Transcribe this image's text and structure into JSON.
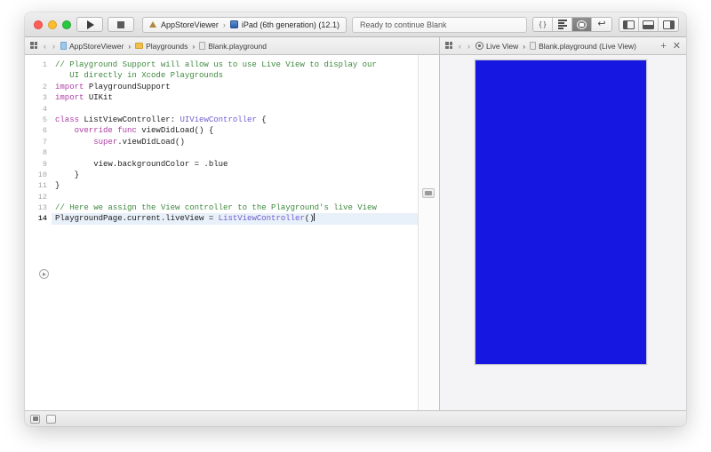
{
  "window": {
    "traffic_lights": [
      "close",
      "minimize",
      "zoom"
    ]
  },
  "toolbar": {
    "run_label": "Run",
    "stop_label": "Stop",
    "scheme_name": "AppStoreViewer",
    "scheme_separator": "›",
    "destination": "iPad (6th generation) (12.1)",
    "status_text": "Ready to continue Blank",
    "editor_segments": [
      {
        "name": "code-braces",
        "glyph": "{ }",
        "active": false
      },
      {
        "name": "standard-editor",
        "glyph": "",
        "active": false
      },
      {
        "name": "assistant-editor",
        "glyph": "",
        "active": true
      },
      {
        "name": "version-editor",
        "glyph": "↩",
        "active": false
      }
    ],
    "view_toggles": [
      {
        "name": "navigator",
        "state": "hidden"
      },
      {
        "name": "debug-area",
        "state": "hidden"
      },
      {
        "name": "inspector",
        "state": "hidden"
      }
    ]
  },
  "editor_pane": {
    "jumpbar": {
      "back_glyph": "‹",
      "forward_glyph": "›",
      "separator": "›",
      "crumbs": [
        {
          "label": "AppStoreViewer",
          "icon": "project-icon"
        },
        {
          "label": "Playgrounds",
          "icon": "folder-icon"
        },
        {
          "label": "Blank.playground",
          "icon": "playground-icon"
        }
      ]
    },
    "lines": [
      {
        "n": "1",
        "tokens": [
          {
            "t": "// Playground Support will allow us to use Live View to display our",
            "c": "k-comment"
          }
        ]
      },
      {
        "n": "",
        "tokens": [
          {
            "t": "   UI directly in Xcode Playgrounds",
            "c": "k-comment"
          }
        ]
      },
      {
        "n": "2",
        "tokens": [
          {
            "t": "import ",
            "c": "k-keyword"
          },
          {
            "t": "PlaygroundSupport",
            "c": "k-plain"
          }
        ]
      },
      {
        "n": "3",
        "tokens": [
          {
            "t": "import ",
            "c": "k-keyword"
          },
          {
            "t": "UIKit",
            "c": "k-plain"
          }
        ]
      },
      {
        "n": "4",
        "tokens": [
          {
            "t": "",
            "c": "k-plain"
          }
        ]
      },
      {
        "n": "5",
        "tokens": [
          {
            "t": "class ",
            "c": "k-keyword"
          },
          {
            "t": "ListViewController",
            "c": "k-plain"
          },
          {
            "t": ": ",
            "c": "k-plain"
          },
          {
            "t": "UIViewController",
            "c": "k-type"
          },
          {
            "t": " {",
            "c": "k-plain"
          }
        ]
      },
      {
        "n": "6",
        "tokens": [
          {
            "t": "    ",
            "c": "k-plain"
          },
          {
            "t": "override func ",
            "c": "k-keyword"
          },
          {
            "t": "viewDidLoad() {",
            "c": "k-plain"
          }
        ]
      },
      {
        "n": "7",
        "tokens": [
          {
            "t": "        ",
            "c": "k-plain"
          },
          {
            "t": "super",
            "c": "k-keyword"
          },
          {
            "t": ".viewDidLoad()",
            "c": "k-plain"
          }
        ]
      },
      {
        "n": "8",
        "tokens": [
          {
            "t": "",
            "c": "k-plain"
          }
        ]
      },
      {
        "n": "9",
        "tokens": [
          {
            "t": "        view.backgroundColor = .blue",
            "c": "k-plain"
          }
        ]
      },
      {
        "n": "10",
        "tokens": [
          {
            "t": "    }",
            "c": "k-plain"
          }
        ]
      },
      {
        "n": "11",
        "tokens": [
          {
            "t": "}",
            "c": "k-plain"
          }
        ]
      },
      {
        "n": "12",
        "tokens": [
          {
            "t": "",
            "c": "k-plain"
          }
        ]
      },
      {
        "n": "13",
        "tokens": [
          {
            "t": "// Here we assign the View controller to the Playground's live View",
            "c": "k-comment"
          }
        ]
      },
      {
        "n": "14",
        "tokens": [
          {
            "t": "PlaygroundPage.current.liveView = ",
            "c": "k-plain"
          },
          {
            "t": "ListViewController",
            "c": "k-type"
          },
          {
            "t": "()",
            "c": "k-plain"
          }
        ],
        "current": true,
        "caret": true
      }
    ],
    "execute_button_label": "Execute Playground",
    "result_marker_line": "9"
  },
  "live_pane": {
    "jumpbar": {
      "back_glyph": "‹",
      "forward_glyph": "›",
      "separator": "›",
      "crumbs": [
        {
          "label": "Live View",
          "icon": "live-view-icon"
        },
        {
          "label": "Blank.playground (Live View)",
          "icon": "playground-icon"
        }
      ],
      "add_glyph": "+",
      "close_glyph": "✕"
    },
    "device_background_color": "#1617e0"
  },
  "bottom_bar": {
    "buttons": [
      {
        "name": "filter-navigator",
        "style": "filled"
      },
      {
        "name": "toggle-panel",
        "style": "plain"
      }
    ]
  }
}
